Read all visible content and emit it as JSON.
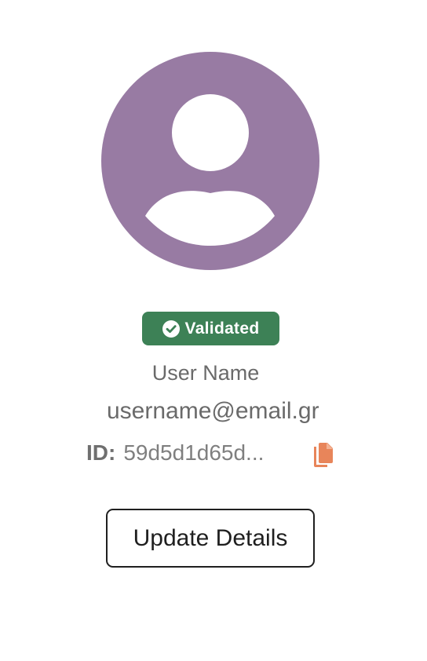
{
  "profile": {
    "avatar_icon": "user-avatar-icon",
    "avatar_color": "#987ba3",
    "status": {
      "label": "Validated",
      "icon": "check-circle-icon",
      "color": "#3d8156"
    },
    "user_name": "User Name",
    "email": "username@email.gr",
    "id_label": "ID:",
    "id_value": "59d5d1d65d...",
    "copy_icon": "copy-icon",
    "copy_icon_color": "#e8855a",
    "update_button_label": "Update Details"
  }
}
